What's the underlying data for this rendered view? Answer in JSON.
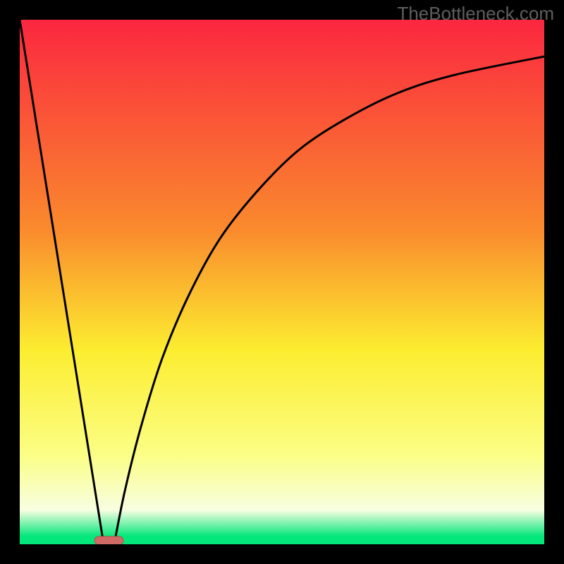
{
  "watermark": "TheBottleneck.com",
  "colors": {
    "frame": "#000000",
    "top": "#fb2740",
    "mid_upper": "#fa8a2d",
    "mid": "#fced30",
    "lower": "#fbfe85",
    "bottom_band": "#f8fee1",
    "green": "#03e77b",
    "curve": "#000000",
    "marker_fill": "#cf6a66",
    "marker_stroke": "#b14f4b"
  },
  "chart_data": {
    "type": "line",
    "title": "",
    "xlabel": "",
    "ylabel": "",
    "xlim": [
      0,
      100
    ],
    "ylim": [
      0,
      100
    ],
    "series": [
      {
        "name": "left-branch",
        "x": [
          0,
          16
        ],
        "y": [
          100,
          0
        ]
      },
      {
        "name": "right-branch",
        "x": [
          18,
          20,
          23,
          27,
          32,
          38,
          45,
          53,
          62,
          72,
          83,
          100
        ],
        "y": [
          0,
          10,
          22,
          35,
          47,
          58,
          67,
          75,
          81,
          86,
          89.5,
          93
        ]
      }
    ],
    "marker": {
      "x": 17,
      "y": 0.7,
      "w": 5.5,
      "h": 1.6
    },
    "gradient_stops": [
      {
        "offset": 0,
        "key": "top"
      },
      {
        "offset": 0.4,
        "key": "mid_upper"
      },
      {
        "offset": 0.63,
        "key": "mid"
      },
      {
        "offset": 0.83,
        "key": "lower"
      },
      {
        "offset": 0.935,
        "key": "bottom_band"
      },
      {
        "offset": 0.985,
        "key": "green"
      },
      {
        "offset": 1.0,
        "key": "green"
      }
    ]
  }
}
